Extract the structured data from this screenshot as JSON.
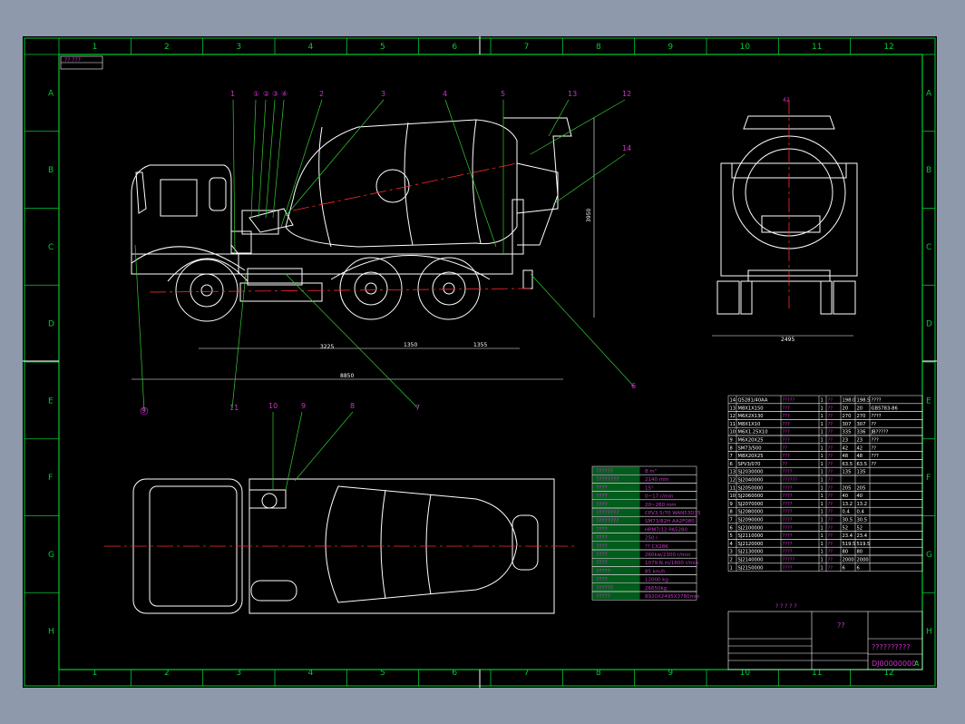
{
  "colors": {
    "frame": "#00cc33",
    "drawing": "#ffffff",
    "leader": "#33cc33",
    "label": "#cc33cc",
    "center": "#ff2a2a",
    "bg": "#000000",
    "outer": "#8e9aab"
  },
  "ruler": {
    "columns": [
      "1",
      "2",
      "3",
      "4",
      "5",
      "6",
      "7",
      "8",
      "9",
      "10",
      "11",
      "12"
    ],
    "rows": [
      "A",
      "B",
      "C",
      "D",
      "E",
      "F",
      "G",
      "H"
    ]
  },
  "title_tag": "?? ???",
  "balloons": [
    "1",
    "①",
    "②",
    "③",
    "④",
    "2",
    "3",
    "4",
    "5",
    "13",
    "12",
    "14",
    "6",
    "7",
    "9",
    "11",
    "10",
    "9",
    "8"
  ],
  "dims": {
    "height": "3950",
    "length1": "3225",
    "length2": "1350",
    "length3": "1355",
    "total": "8850",
    "width": "2495",
    "top": "42"
  },
  "spec_table": [
    [
      "??????",
      "8  m³"
    ],
    [
      "????????",
      "2140  mm"
    ],
    [
      "????",
      "15°"
    ],
    [
      "????",
      "0~17  r/min"
    ],
    [
      "????",
      "20~260  mm"
    ],
    [
      "????????",
      "CPV3.5/70 WAN53D35"
    ],
    [
      "????????",
      "SM73/82H  AA2F080"
    ],
    [
      "????",
      "HPM7/12  PA5280"
    ],
    [
      "????",
      "250  l"
    ],
    [
      "????",
      "??    CX28K"
    ],
    [
      "????",
      "260kw/2300  r/min"
    ],
    [
      "????",
      "1079  N.m/1600  r/min"
    ],
    [
      "?????",
      "85  km/h"
    ],
    [
      "????",
      "12000  kg"
    ],
    [
      "??????",
      "26650kg"
    ],
    [
      "?????",
      "8920X2495X3780mm"
    ]
  ],
  "bom_rows": [
    [
      "14",
      "Q5281/40AA",
      "?????",
      "1",
      "??",
      "198.0",
      "198.5",
      "????"
    ],
    [
      "13",
      "M8X1X150",
      "???",
      "1",
      "??",
      "20",
      "20",
      "GB5783-86"
    ],
    [
      "12",
      "M6X2X130",
      "???",
      "1",
      "??",
      "270",
      "270",
      "????"
    ],
    [
      "11",
      "M8X1X10",
      "???",
      "1",
      "??",
      "307",
      "307",
      "??"
    ],
    [
      "10",
      "M6X1.25X10",
      "???",
      "1",
      "??",
      "335",
      "336",
      "JB?????"
    ],
    [
      "9",
      "M6X20X25",
      "???",
      "1",
      "??",
      "23",
      "23",
      "???"
    ],
    [
      "8",
      "SM73/500",
      "??",
      "1",
      "??",
      "42",
      "42",
      "??"
    ],
    [
      "7",
      "M8X20X25",
      "???",
      "1",
      "??",
      "48",
      "48",
      "???"
    ],
    [
      "6",
      "SPV3/070",
      "??",
      "1",
      "??",
      "63.5",
      "63.5",
      "??"
    ],
    [
      "13",
      "SJ2030000",
      "????",
      "1",
      "??",
      "135",
      "135",
      ""
    ],
    [
      "12",
      "SJ2040000",
      "??????",
      "1",
      "??",
      "",
      "",
      ""
    ],
    [
      "11",
      "SJ2050000",
      "????",
      "1",
      "??",
      "205",
      "205",
      ""
    ],
    [
      "10",
      "SJ2060000",
      "????",
      "1",
      "??",
      "40",
      "40",
      ""
    ],
    [
      "9",
      "SJ2070000",
      "????",
      "1",
      "??",
      "13.2",
      "13.2",
      ""
    ],
    [
      "8",
      "SJ2080000",
      "????",
      "1",
      "??",
      "0.4",
      "0.4",
      ""
    ],
    [
      "7",
      "SJ2090000",
      "????",
      "1",
      "??",
      "30.5",
      "30.5",
      ""
    ],
    [
      "6",
      "SJ2100000",
      "????",
      "1",
      "??",
      "52",
      "52",
      ""
    ],
    [
      "5",
      "SJ2110000",
      "????",
      "1",
      "??",
      "23.4",
      "23.4",
      ""
    ],
    [
      "4",
      "SJ2120000",
      "????",
      "1",
      "??",
      "519.5",
      "519.5",
      ""
    ],
    [
      "3",
      "SJ2130000",
      "????",
      "1",
      "??",
      "80",
      "80",
      ""
    ],
    [
      "2",
      "SJ2140000",
      "?????",
      "1",
      "??",
      "2000",
      "2000",
      ""
    ],
    [
      "1",
      "SJ2150000",
      "????",
      "1",
      "??",
      "6",
      "6",
      ""
    ]
  ],
  "title_block": {
    "name": "??",
    "code_label": "??????????",
    "drawing_no": "DJ00000000",
    "mark": "A",
    "header": "? ? ? ? ?"
  }
}
